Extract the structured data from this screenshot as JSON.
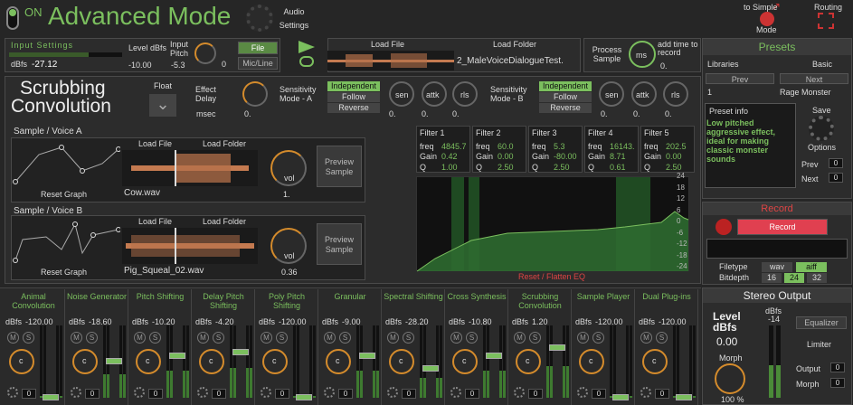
{
  "header": {
    "power_label": "ON",
    "title": "Advanced Mode",
    "audio_settings": "Audio Settings",
    "to_simple": "to Simple",
    "mode": "Mode",
    "routing": "Routing"
  },
  "input": {
    "title": "Input Settings",
    "dbfs_label": "dBfs",
    "dbfs_value": "-27.12",
    "level_label": "Level dBfs",
    "level_value": "-10.00",
    "pitch_label": "Input Pitch",
    "pitch_value": "-5.3",
    "pitch_knob": "0",
    "file": "File",
    "micline": "Mic/Line"
  },
  "loader": {
    "load_file": "Load File",
    "load_folder": "Load Folder",
    "filename": "2_MaleVoiceDialogueTest.",
    "process": "Process Sample",
    "ms": "ms",
    "add_time": "add time to record",
    "add_time_val": "0."
  },
  "presets": {
    "title": "Presets",
    "libraries": "Libraries",
    "library_value": "Basic",
    "prev": "Prev",
    "next": "Next",
    "preset_num": "1",
    "preset_name": "Rage Monster",
    "info_label": "Preset info",
    "info_text": "Low pitched aggressive effect, ideal for making classic monster sounds",
    "save": "Save",
    "options": "Options",
    "prev2": "Prev",
    "next2": "Next",
    "prev_val": "0",
    "next_val": "0"
  },
  "scrub": {
    "title1": "Scrubbing",
    "title2": "Convolution",
    "float": "Float",
    "effect_delay": "Effect Delay",
    "msec": "msec",
    "delay_val": "0.",
    "sensA": "Sensitivity Mode - A",
    "sensB": "Sensitivity Mode - B",
    "independent": "Independent",
    "follow": "Follow",
    "reverse": "Reverse",
    "sen": "sen",
    "attk": "attk",
    "rls": "rls",
    "senA": "0.",
    "attkA": "0.",
    "rlsA": "0.",
    "senB": "0.",
    "attkB": "0.",
    "rlsB": "0."
  },
  "voiceA": {
    "title": "Sample / Voice  A",
    "load_file": "Load File",
    "load_folder": "Load Folder",
    "filename": "Cow.wav",
    "reset": "Reset Graph",
    "vol": "vol",
    "vol_val": "1.",
    "preview": "Preview Sample"
  },
  "voiceB": {
    "title": "Sample / Voice  B",
    "load_file": "Load File",
    "load_folder": "Load Folder",
    "filename": "Pig_Squeal_02.wav",
    "reset": "Reset Graph",
    "vol": "vol",
    "vol_val": "0.36",
    "preview": "Preview Sample"
  },
  "filters": [
    {
      "name": "Filter 1",
      "freq": "4845.7",
      "gain": "0.42",
      "q": "1.00"
    },
    {
      "name": "Filter 2",
      "freq": "60.0",
      "gain": "0.00",
      "q": "2.50"
    },
    {
      "name": "Filter 3",
      "freq": "5.3",
      "gain": "-80.00",
      "q": "2.50"
    },
    {
      "name": "Filter 4",
      "freq": "16143.",
      "gain": "8.71",
      "q": "0.61"
    },
    {
      "name": "Filter 5",
      "freq": "202.5",
      "gain": "0.00",
      "q": "2.50"
    }
  ],
  "eq": {
    "reset": "Reset / Flatten EQ",
    "ticks": [
      "24",
      "18",
      "12",
      "6",
      "0",
      "-6",
      "-12",
      "-18",
      "-24"
    ],
    "freq_lbl": "freq",
    "gain_lbl": "Gain",
    "q_lbl": "Q"
  },
  "record": {
    "title": "Record",
    "button": "Record",
    "filetype": "Filetype",
    "wav": "wav",
    "aiff": "aiff",
    "bitdepth": "Bitdepth",
    "b16": "16",
    "b24": "24",
    "b32": "32"
  },
  "modules": [
    {
      "name": "Animal Convolution",
      "db": "-120.00",
      "level": 0.05
    },
    {
      "name": "Noise Generator",
      "db": "-18.60",
      "level": 0.55
    },
    {
      "name": "Pitch Shifting",
      "db": "-10.20",
      "level": 0.62
    },
    {
      "name": "Delay Pitch Shifting",
      "db": "-4.20",
      "level": 0.68
    },
    {
      "name": "Poly Pitch Shifting",
      "db": "-120.00",
      "level": 0.05
    },
    {
      "name": "Granular",
      "db": "-9.00",
      "level": 0.63
    },
    {
      "name": "Spectral Shifting",
      "db": "-28.20",
      "level": 0.45
    },
    {
      "name": "Cross Synthesis",
      "db": "-10.80",
      "level": 0.62
    },
    {
      "name": "Scrubbing Convolution",
      "db": "1.20",
      "level": 0.74
    },
    {
      "name": "Sample Player",
      "db": "-120.00",
      "level": 0.05
    },
    {
      "name": "Dual Plug-ins",
      "db": "-120.00",
      "level": 0.05
    }
  ],
  "module_common": {
    "dbfs": "dBfs",
    "m": "M",
    "s": "S",
    "c": "c",
    "zero": "0"
  },
  "output": {
    "title": "Stereo Output",
    "level": "Level dBfs",
    "level_val": "0.00",
    "dbfs": "dBfs",
    "dbfs_val": "-14",
    "morph": "Morph",
    "morph_val": "100 %",
    "equalizer": "Equalizer",
    "limiter": "Limiter",
    "output": "Output",
    "morph2": "Morph",
    "out_val": "0",
    "morph_num": "0"
  }
}
